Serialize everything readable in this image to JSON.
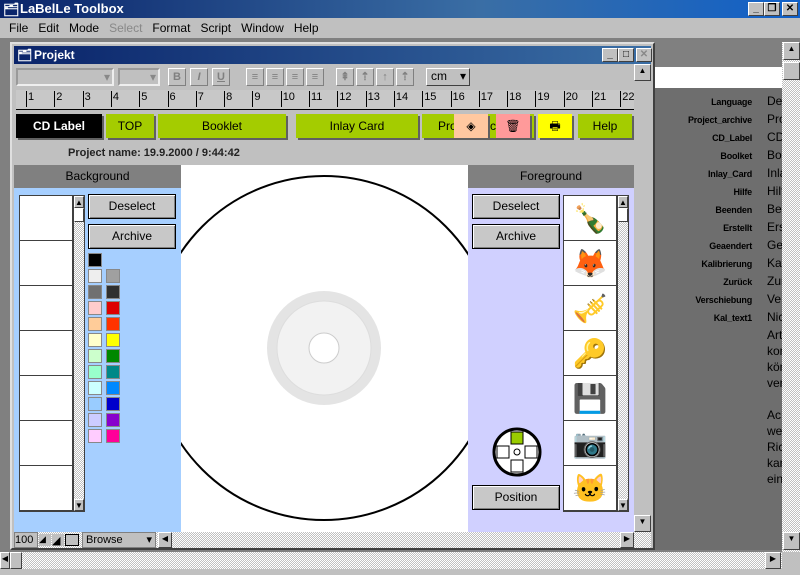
{
  "app": {
    "title": "LaBelLe Toolbox",
    "window_buttons": [
      "_",
      "❐",
      "✕"
    ]
  },
  "menu": [
    {
      "label": "File",
      "disabled": false
    },
    {
      "label": "Edit",
      "disabled": false
    },
    {
      "label": "Mode",
      "disabled": false
    },
    {
      "label": "Select",
      "disabled": true
    },
    {
      "label": "Format",
      "disabled": false
    },
    {
      "label": "Script",
      "disabled": false
    },
    {
      "label": "Window",
      "disabled": false
    },
    {
      "label": "Help",
      "disabled": false
    }
  ],
  "project": {
    "title": "Projekt",
    "name_line": "Project name: 19.9.2000 / 9:44:42",
    "unit": "cm",
    "ruler": [
      "1",
      "2",
      "3",
      "4",
      "5",
      "6",
      "7",
      "8",
      "9",
      "10",
      "11",
      "12",
      "13",
      "14",
      "15",
      "16",
      "17",
      "18",
      "19",
      "20",
      "21",
      "22"
    ]
  },
  "toolbar": {
    "format_buttons": [
      "B",
      "I",
      "U"
    ],
    "align_buttons": [
      "≡",
      "≡",
      "≡",
      "≡"
    ],
    "layer_buttons": [
      "⇞",
      "⇡",
      "↑",
      "⇡"
    ]
  },
  "tabs": [
    {
      "label": "CD Label",
      "active": true
    },
    {
      "label": "TOP"
    },
    {
      "label": "Booklet"
    },
    {
      "label": "Inlay Card"
    },
    {
      "label": "Project Archive"
    }
  ],
  "tool_icons": [
    {
      "icon": "eraser-icon",
      "color": "#ffc8a0"
    },
    {
      "icon": "trash-icon",
      "color": "#ff9a9a"
    },
    {
      "icon": "printer-icon",
      "color": "#ffff00"
    }
  ],
  "help_label": "Help",
  "background": {
    "header": "Background",
    "deselect": "Deselect",
    "archive": "Archive",
    "thumbs": [
      "#8899ee",
      "#ff6600",
      "#cc2200",
      "#444444",
      "#222222",
      "#ff8800",
      "#99ddaa"
    ],
    "palette": [
      [
        "#000000"
      ],
      [
        "#eeeeee",
        "#a0a0a0"
      ],
      [
        "#707070",
        "#303030"
      ],
      [
        "#ffcccc",
        "#dd0000"
      ],
      [
        "#ffcc99",
        "#ff3300"
      ],
      [
        "#ffffcc",
        "#ffff00"
      ],
      [
        "#ccffcc",
        "#008800"
      ],
      [
        "#99ffcc",
        "#008888"
      ],
      [
        "#ccffff",
        "#0088ff"
      ],
      [
        "#99ccff",
        "#0000cc"
      ],
      [
        "#ccccff",
        "#8800cc"
      ],
      [
        "#ffccff",
        "#ff0099"
      ]
    ]
  },
  "foreground": {
    "header": "Foreground",
    "deselect": "Deselect",
    "archive": "Archive",
    "position": "Position",
    "thumbs": [
      "🍾",
      "🦊",
      "🎺",
      "🔑",
      "💾",
      "📷",
      "🐱"
    ]
  },
  "status": {
    "zoom": "100",
    "mode": "Browse"
  },
  "properties": [
    {
      "key": "Language",
      "value": "De"
    },
    {
      "key": "Project_archive",
      "value": "Pro"
    },
    {
      "key": "CD_Label",
      "value": "CD"
    },
    {
      "key": "Boolket",
      "value": "Bo"
    },
    {
      "key": "Inlay_Card",
      "value": "Inla"
    },
    {
      "key": "Hilfe",
      "value": "Hilf"
    },
    {
      "key": "Beenden",
      "value": "Be"
    },
    {
      "key": "Erstellt",
      "value": "Ers"
    },
    {
      "key": "Geaendert",
      "value": "Ge"
    },
    {
      "key": "Kalibrierung",
      "value": "Ka"
    },
    {
      "key": "Zurück",
      "value": "Zur"
    },
    {
      "key": "Verschiebung",
      "value": "Ve"
    },
    {
      "key": "Kal_text1",
      "value": "Nic"
    }
  ],
  "kal_text_lines": [
    "Art",
    "kor",
    "kön",
    "ver",
    "",
    "Ac",
    "we",
    "Ric",
    "kar",
    "ein"
  ]
}
